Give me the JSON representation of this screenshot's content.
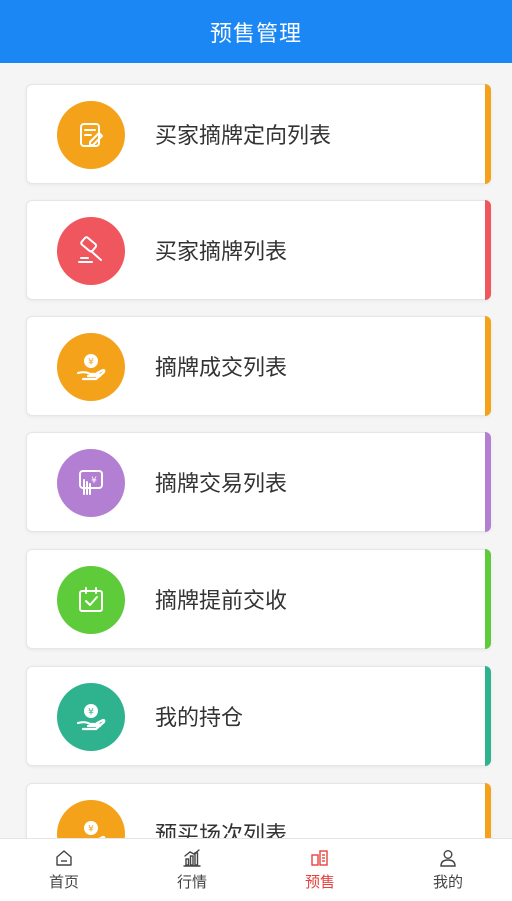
{
  "header": {
    "title": "预售管理"
  },
  "items": [
    {
      "label": "买家摘牌定向列表",
      "color": "#f5a21b",
      "icon": "document-edit-icon"
    },
    {
      "label": "买家摘牌列表",
      "color": "#f0565e",
      "icon": "gavel-icon"
    },
    {
      "label": "摘牌成交列表",
      "color": "#f5a21b",
      "icon": "yen-hand-icon"
    },
    {
      "label": "摘牌交易列表",
      "color": "#b37fd2",
      "icon": "hand-receipt-icon"
    },
    {
      "label": "摘牌提前交收",
      "color": "#5ecb3b",
      "icon": "calendar-check-icon"
    },
    {
      "label": "我的持仓",
      "color": "#2fb38e",
      "icon": "yen-hand-icon"
    },
    {
      "label": "预买场次列表",
      "color": "#f5a21b",
      "icon": "yen-hand-icon"
    }
  ],
  "tabbar": [
    {
      "label": "首页",
      "icon": "home-icon",
      "active": false
    },
    {
      "label": "行情",
      "icon": "market-chart-icon",
      "active": false
    },
    {
      "label": "预售",
      "icon": "presale-icon",
      "active": true
    },
    {
      "label": "我的",
      "icon": "user-icon",
      "active": false
    }
  ],
  "colors": {
    "header": "#1a87f5",
    "active_tab": "#e8423f"
  }
}
